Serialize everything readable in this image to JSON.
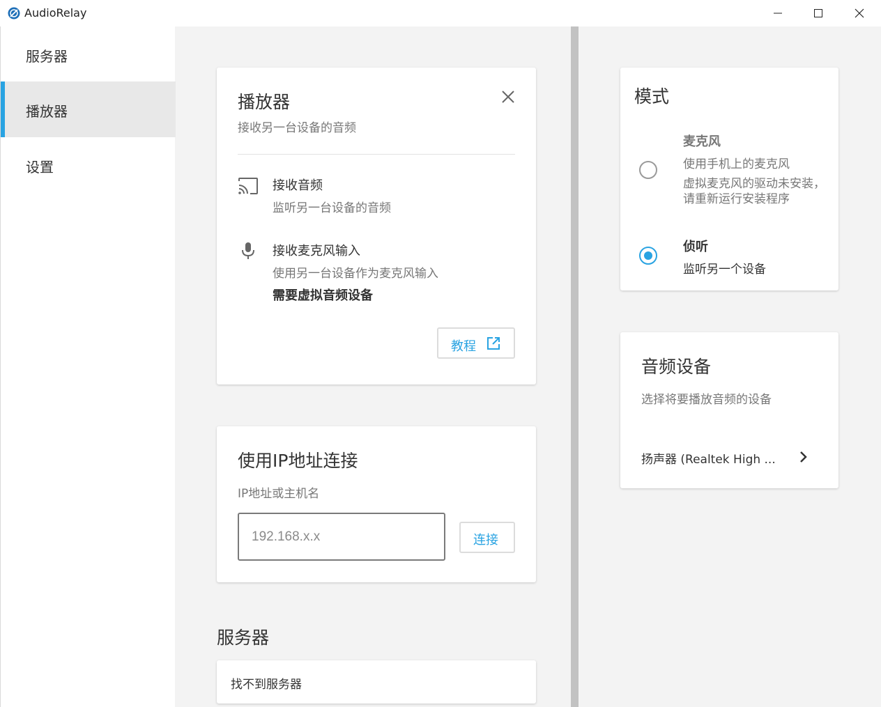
{
  "window": {
    "title": "AudioRelay",
    "minimize_icon": "minimize-icon",
    "maximize_icon": "maximize-icon",
    "close_icon": "close-icon"
  },
  "sidebar": {
    "items": [
      {
        "label": "服务器",
        "active": false
      },
      {
        "label": "播放器",
        "active": true
      },
      {
        "label": "设置",
        "active": false
      }
    ],
    "accent_color": "#29a3e2"
  },
  "player_card": {
    "title": "播放器",
    "subtitle": "接收另一台设备的音频",
    "close_icon": "close-icon",
    "features": [
      {
        "icon": "cast-icon",
        "title": "接收音频",
        "description": "监听另一台设备的音频",
        "note": ""
      },
      {
        "icon": "microphone-icon",
        "title": "接收麦克风输入",
        "description": "使用另一台设备作为麦克风输入",
        "note": "需要虚拟音频设备"
      }
    ],
    "tutorial_label": "教程",
    "tutorial_icon": "external-link-icon"
  },
  "ip_card": {
    "title": "使用IP地址连接",
    "label": "IP地址或主机名",
    "input_value": "",
    "input_placeholder": "192.168.x.x",
    "connect_label": "连接"
  },
  "servers_section": {
    "title": "服务器",
    "empty_text": "找不到服务器"
  },
  "mode_card": {
    "title": "模式",
    "options": [
      {
        "title": "麦克风",
        "description": "使用手机上的麦克风",
        "warning": "虚拟麦克风的驱动未安装，请重新运行安装程序",
        "selected": false
      },
      {
        "title": "侦听",
        "description": "监听另一个设备",
        "warning": "",
        "selected": true
      }
    ]
  },
  "audio_device_card": {
    "title": "音频设备",
    "subtitle": "选择将要播放音频的设备",
    "device": "扬声器 (Realtek High ...",
    "chevron_icon": "chevron-right-icon"
  }
}
